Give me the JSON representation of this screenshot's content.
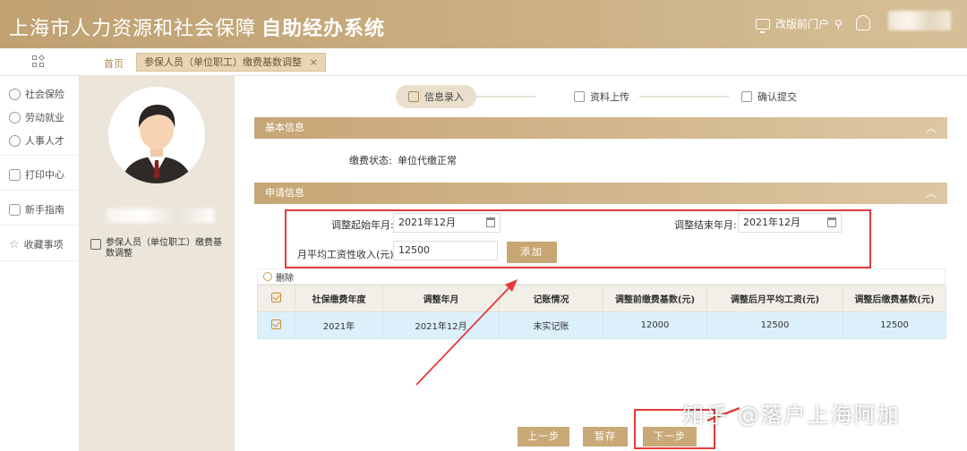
{
  "header": {
    "title_main": "上海市人力资源和社会保障",
    "title_bold": "自助经办系统",
    "portal_link": "改版前门户"
  },
  "tabs": {
    "home": "首页",
    "active": "参保人员（单位职工）缴费基数调整",
    "close": "×"
  },
  "nav": {
    "items": [
      "社会保险",
      "劳动就业",
      "人事人才",
      "打印中心",
      "新手指南",
      "收藏事项"
    ]
  },
  "profile": {
    "business_item": "参保人员（单位职工）缴费基数调整"
  },
  "steps": [
    "信息录入",
    "资料上传",
    "确认提交"
  ],
  "basic_info": {
    "title": "基本信息",
    "status_label": "缴费状态:",
    "status_value": "单位代缴正常"
  },
  "application": {
    "title": "申请信息",
    "start_label": "调整起始年月:",
    "start_value": "2021年12月",
    "end_label": "调整结束年月:",
    "end_value": "2021年12月",
    "income_label": "月平均工资性收入(元):",
    "income_value": "12500",
    "add_button": "添加"
  },
  "table": {
    "delete_label": "删除",
    "headers": [
      "社保缴费年度",
      "调整年月",
      "记账情况",
      "调整前缴费基数(元)",
      "调整后月平均工资(元)",
      "调整后缴费基数(元)"
    ],
    "rows": [
      [
        "2021年",
        "2021年12月",
        "未实记账",
        "12000",
        "12500",
        "12500"
      ]
    ]
  },
  "footer": {
    "prev": "上一步",
    "save": "暂存",
    "next": "下一步"
  },
  "watermark": "知乎 @落户上海阿加",
  "colors": {
    "brand": "#c6a676",
    "highlight": "#e33b3b",
    "row_selected": "#dcf0fb"
  }
}
